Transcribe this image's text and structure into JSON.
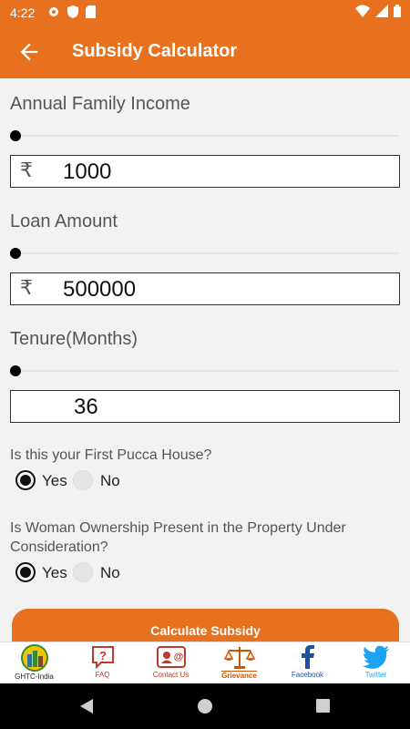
{
  "status": {
    "time": "4:22"
  },
  "appbar": {
    "title": "Subsidy Calculator"
  },
  "income": {
    "label": "Annual Family Income",
    "currency": "₹",
    "value": "1000",
    "slider_fraction": 0
  },
  "loan": {
    "label": "Loan Amount",
    "currency": "₹",
    "value": "500000",
    "slider_fraction": 0
  },
  "tenure": {
    "label": "Tenure(Months)",
    "value": "36",
    "slider_fraction": 0
  },
  "q1": {
    "question": "Is this your First Pucca House?",
    "yes": "Yes",
    "no": "No",
    "selected": "Yes"
  },
  "q2": {
    "question": "Is Woman Ownership Present in the Property Under Consideration?",
    "yes": "Yes",
    "no": "No",
    "selected": "Yes"
  },
  "calc_button": "Calculate Subsidy",
  "nav": {
    "ghtc": "GHTC-India",
    "faq": "FAQ",
    "contact": "Contact Us",
    "grievance": "Grievance",
    "facebook": "Facebook",
    "twitter": "Twitter"
  },
  "colors": {
    "accent": "#e8711f",
    "twitter": "#1da1f2",
    "facebook": "#1f4fa3"
  }
}
